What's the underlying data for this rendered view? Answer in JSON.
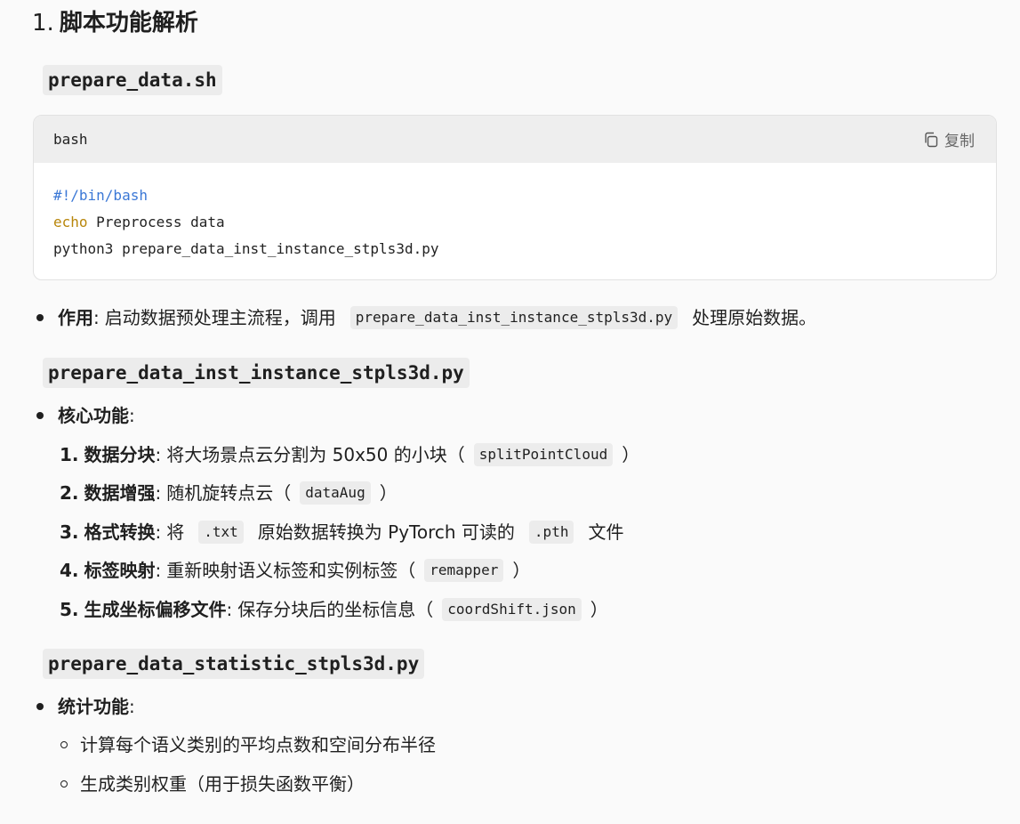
{
  "section": {
    "number": "1.",
    "title": "脚本功能解析"
  },
  "file1": {
    "name": "prepare_data.sh",
    "code": {
      "lang": "bash",
      "copy_label": "复制",
      "lines": {
        "shebang": "#!/bin/bash",
        "echo_kw": "echo",
        "echo_rest": " Preprocess data",
        "python_line": "python3 prepare_data_inst_instance_stpls3d.py"
      }
    },
    "bullet": {
      "label": "作用",
      "colon": ":",
      "text_before": "启动数据预处理主流程，调用",
      "code": "prepare_data_inst_instance_stpls3d.py",
      "text_after": "处理原始数据。"
    }
  },
  "file2": {
    "name": "prepare_data_inst_instance_stpls3d.py",
    "bullet": {
      "label": "核心功能",
      "colon": ":"
    },
    "items": [
      {
        "num": "1.",
        "label": "数据分块",
        "colon": ":",
        "text": "将大场景点云分割为 50x50 的小块（",
        "code": "splitPointCloud",
        "after": "）",
        "mid": "",
        "code2": "",
        "tail": ""
      },
      {
        "num": "2.",
        "label": "数据增强",
        "colon": ":",
        "text": "随机旋转点云（",
        "code": "dataAug",
        "after": "）",
        "mid": "",
        "code2": "",
        "tail": ""
      },
      {
        "num": "3.",
        "label": "格式转换",
        "colon": ":",
        "text": "将",
        "code": ".txt",
        "after": "",
        "mid": "原始数据转换为 PyTorch 可读的",
        "code2": ".pth",
        "tail": "文件"
      },
      {
        "num": "4.",
        "label": "标签映射",
        "colon": ":",
        "text": "重新映射语义标签和实例标签（",
        "code": "remapper",
        "after": "）",
        "mid": "",
        "code2": "",
        "tail": ""
      },
      {
        "num": "5.",
        "label": "生成坐标偏移文件",
        "colon": ":",
        "text": "保存分块后的坐标信息（",
        "code": "coordShift.json",
        "after": "）",
        "mid": "",
        "code2": "",
        "tail": ""
      }
    ]
  },
  "file3": {
    "name": "prepare_data_statistic_stpls3d.py",
    "bullet": {
      "label": "统计功能",
      "colon": ":"
    },
    "sub": [
      "计算每个语义类别的平均点数和空间分布半径",
      "生成类别权重（用于损失函数平衡）"
    ]
  }
}
